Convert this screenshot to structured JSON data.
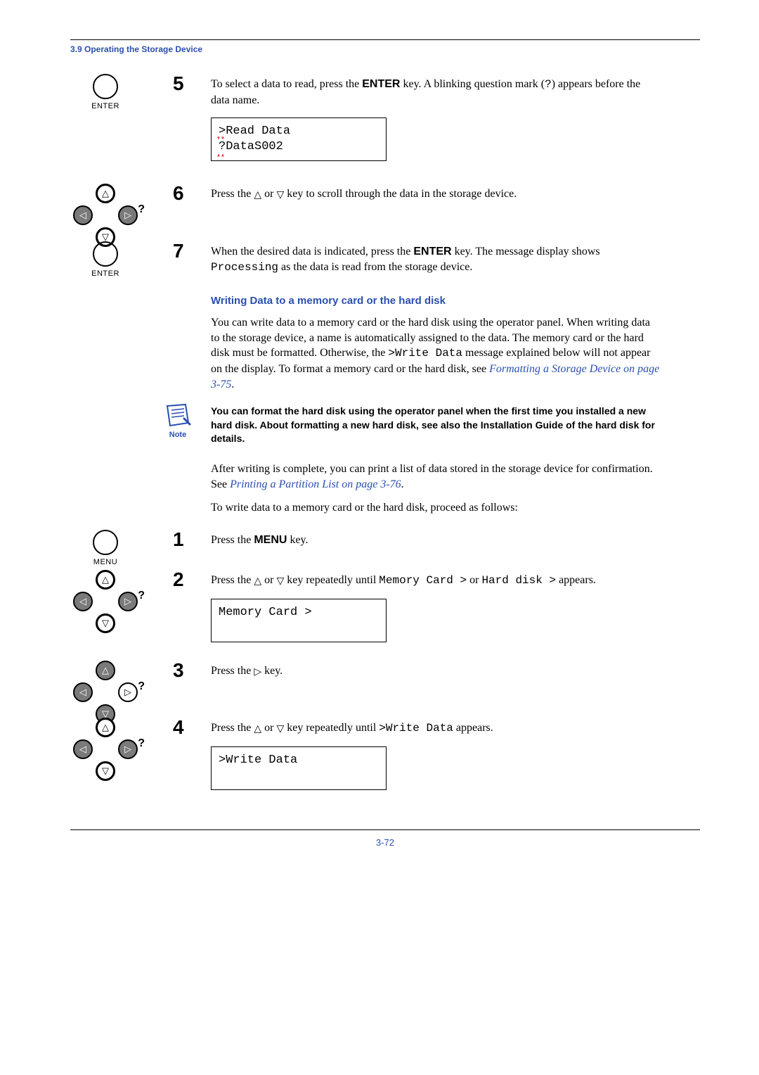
{
  "section_header": "3.9 Operating the Storage Device",
  "steps_a": {
    "5": {
      "num": "5",
      "icon_label": "ENTER",
      "text_pre": "To select a data to read, press the ",
      "key": "ENTER",
      "text_post": " key. A blinking question mark (",
      "qmark": "?",
      "text_post2": ") appears before the data name.",
      "lcd": {
        "l1": ">Read Data",
        "l2": "?DataS002"
      }
    },
    "6": {
      "num": "6",
      "text_pre": "Press the ",
      "text_mid": " or ",
      "text_post": " key to scroll through the data in the storage device."
    },
    "7": {
      "num": "7",
      "icon_label": "ENTER",
      "text_pre": "When the desired data is indicated, press the ",
      "key": "ENTER",
      "text_mid": " key. The message display shows ",
      "code": "Processing",
      "text_post": " as the data is read from the storage device."
    }
  },
  "writing": {
    "heading": "Writing Data to a memory card or the hard disk",
    "p1_pre": "You can write data to a memory card or the hard disk using the operator panel. When writing data to the storage device, a name is automatically assigned to the data. The memory card or the hard disk must be formatted. Otherwise, the ",
    "p1_code": ">Write Data",
    "p1_mid": " message explained below will not appear on the display. To format a memory card or the hard disk, see ",
    "p1_link": "Formatting a Storage Device on page 3-75",
    "p1_end": ".",
    "note": "You can format the hard disk using the operator panel when the first time you installed a new hard disk. About formatting a new hard disk, see also the Installation Guide of the hard disk for details.",
    "note_label": "Note",
    "p2_pre": "After writing is complete, you can print a list of data stored in the storage device for confirmation. See ",
    "p2_link": "Printing a Partition List on page 3-76",
    "p2_end": ".",
    "p3": "To write data to a memory card or the hard disk, proceed as follows:"
  },
  "steps_b": {
    "1": {
      "num": "1",
      "icon_label": "MENU",
      "text_pre": "Press the ",
      "key": "MENU",
      "text_post": " key."
    },
    "2": {
      "num": "2",
      "text_pre": "Press the ",
      "text_mid": " or ",
      "text_mid2": " key repeatedly until ",
      "code1": "Memory Card >",
      "text_or": " or ",
      "code2": "Hard disk >",
      "text_post": " appears.",
      "lcd": {
        "l1": "Memory Card    >"
      }
    },
    "3": {
      "num": "3",
      "text_pre": "Press the ",
      "text_post": " key."
    },
    "4": {
      "num": "4",
      "text_pre": "Press the ",
      "text_mid": " or ",
      "text_mid2": " key repeatedly until ",
      "code": ">Write Data",
      "text_post": " appears.",
      "lcd": {
        "l1": ">Write Data"
      }
    }
  },
  "page_number": "3-72"
}
